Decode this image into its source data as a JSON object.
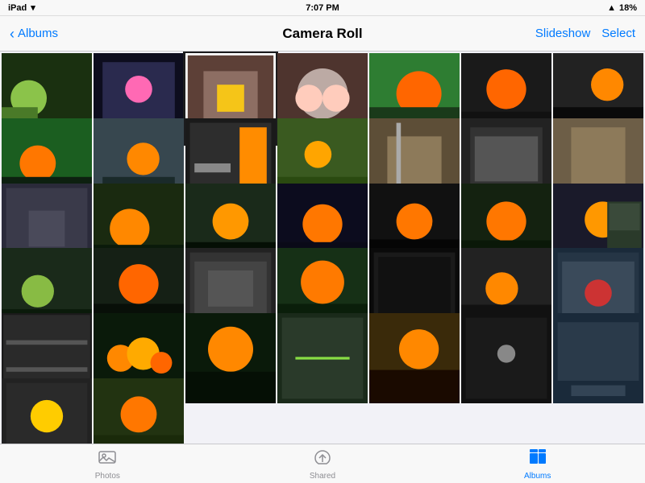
{
  "statusBar": {
    "carrier": "iPad",
    "wifi": "wifi",
    "time": "7:07 PM",
    "signal": "▲",
    "battery": "18%"
  },
  "navBar": {
    "backLabel": "Albums",
    "title": "Camera Roll",
    "slideshowLabel": "Slideshow",
    "selectLabel": "Select"
  },
  "tabBar": {
    "items": [
      {
        "id": "photos",
        "label": "Photos",
        "icon": "⬜",
        "active": false
      },
      {
        "id": "shared",
        "label": "Shared",
        "icon": "☁",
        "active": false
      },
      {
        "id": "albums",
        "label": "Albums",
        "icon": "📁",
        "active": true
      }
    ]
  },
  "photos": [
    {
      "id": 1,
      "bg": "#2d4a1e",
      "accent": "#8bc34a",
      "type": "plant"
    },
    {
      "id": 2,
      "bg": "#1a1a2e",
      "accent": "#e91e63",
      "type": "dark"
    },
    {
      "id": 3,
      "bg": "#3e2723",
      "accent": "#f5c518",
      "type": "wood",
      "selected": true
    },
    {
      "id": 4,
      "bg": "#5d4037",
      "accent": "#ff9800",
      "type": "people"
    },
    {
      "id": 5,
      "bg": "#1b5e20",
      "accent": "#ff6600",
      "type": "flower"
    },
    {
      "id": 6,
      "bg": "#0d0d0d",
      "accent": "#ff6600",
      "type": "dark-flower"
    },
    {
      "id": 7,
      "bg": "#1a1a1a",
      "accent": "#ff6600",
      "type": "dark-flower2"
    },
    {
      "id": 8,
      "bg": "#2e7d32",
      "accent": "#ff6600",
      "type": "flower2"
    },
    {
      "id": 9,
      "bg": "#263238",
      "accent": "#ff6600",
      "type": "flower3"
    },
    {
      "id": 10,
      "bg": "#37474f",
      "accent": "#c8b560",
      "type": "ui"
    },
    {
      "id": 11,
      "bg": "#4a6a2e",
      "accent": "#f5a623",
      "type": "plant2"
    },
    {
      "id": 12,
      "bg": "#3e2723",
      "accent": "#d4c080",
      "type": "sepia"
    },
    {
      "id": 13,
      "bg": "#2d2d2d",
      "accent": "#607d8b",
      "type": "ui2"
    },
    {
      "id": 14,
      "bg": "#5d4e37",
      "accent": "#c8b560",
      "type": "sepia2"
    },
    {
      "id": 15,
      "bg": "#4a4a4a",
      "accent": "#8899aa",
      "type": "ui3"
    },
    {
      "id": 16,
      "bg": "#1a2a1a",
      "accent": "#f5a623",
      "type": "plant3"
    },
    {
      "id": 17,
      "bg": "#0a1a0a",
      "accent": "#ff9800",
      "type": "flower4"
    },
    {
      "id": 18,
      "bg": "#1c1c2e",
      "accent": "#ff6600",
      "type": "flower5"
    },
    {
      "id": 19,
      "bg": "#0a0a0a",
      "accent": "#ff7700",
      "type": "flower6"
    },
    {
      "id": 20,
      "bg": "#1a3020",
      "accent": "#ff6600",
      "type": "flower7"
    },
    {
      "id": 21,
      "bg": "#2a2a3a",
      "accent": "#ff9800",
      "type": "flower8"
    },
    {
      "id": 22,
      "bg": "#1a2a2a",
      "accent": "#88bb44",
      "type": "plant4"
    },
    {
      "id": 23,
      "bg": "#0d1a0d",
      "accent": "#ff6600",
      "type": "flower9"
    },
    {
      "id": 24,
      "bg": "#2d2d2d",
      "accent": "#88aacc",
      "type": "ui4"
    },
    {
      "id": 25,
      "bg": "#1e3a1e",
      "accent": "#ff6600",
      "type": "flower10"
    },
    {
      "id": 26,
      "bg": "#111",
      "accent": "#888",
      "type": "dark2"
    },
    {
      "id": 27,
      "bg": "#1a1a1a",
      "accent": "#ff8800",
      "type": "flower11"
    },
    {
      "id": 28,
      "bg": "#2a3a4a",
      "accent": "#4499dd",
      "type": "ui5"
    },
    {
      "id": 29,
      "bg": "#3a3a3a",
      "accent": "#cc3333",
      "type": "photo-app"
    },
    {
      "id": 30,
      "bg": "#1a1a1a",
      "accent": "#ffaa00",
      "type": "grid"
    },
    {
      "id": 31,
      "bg": "#1a1a2a",
      "accent": "#ffaa00",
      "type": "flower12"
    },
    {
      "id": 32,
      "bg": "#223322",
      "accent": "#88dd44",
      "type": "plant5"
    },
    {
      "id": 33,
      "bg": "#2a1a0a",
      "accent": "#ff8800",
      "type": "flower13"
    },
    {
      "id": 34,
      "bg": "#1a1a1a",
      "accent": "#888888",
      "type": "dark3"
    },
    {
      "id": 35,
      "bg": "#223344",
      "accent": "#ff8800",
      "type": "flower14"
    },
    {
      "id": 36,
      "bg": "#1a1a1a",
      "accent": "#ffcc00",
      "type": "flower15"
    },
    {
      "id": 37,
      "bg": "#334422",
      "accent": "#ff6600",
      "type": "flower16"
    },
    {
      "id": 38,
      "bg": "#111",
      "accent": "#777",
      "type": "dark4"
    },
    {
      "id": 39,
      "bg": "#223311",
      "accent": "#ff8800",
      "type": "flower17"
    },
    {
      "id": 40,
      "bg": "#334433",
      "accent": "#ff7700",
      "type": "flower18"
    },
    {
      "id": 41,
      "bg": "#443322",
      "accent": "#ffaa44",
      "type": "flower19"
    },
    {
      "id": 42,
      "bg": "#1a2a1a",
      "accent": "#ffbb33",
      "type": "flower20"
    }
  ]
}
